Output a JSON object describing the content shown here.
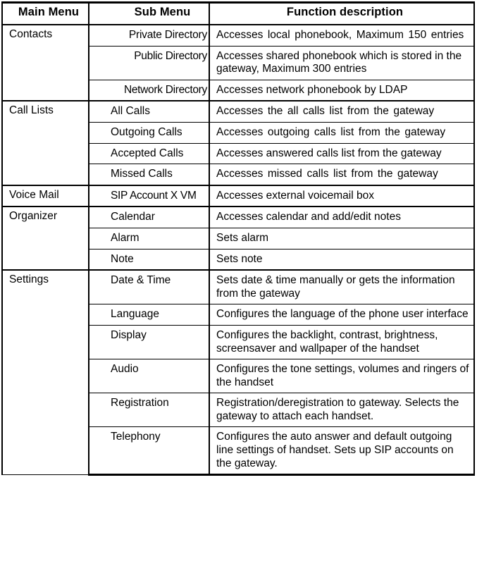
{
  "table": {
    "headers": {
      "main_menu": "Main Menu",
      "sub_menu": "Sub Menu",
      "function_description": "Function description"
    },
    "groups": [
      {
        "main_menu": "Contacts",
        "sub_align": "right",
        "rows": [
          {
            "sub_menu": "Private  Directory",
            "description": "Accesses local phonebook, Maximum 150 entries",
            "desc_spaced": true
          },
          {
            "sub_menu": "Public Directory",
            "description": "Accesses shared phonebook which is stored in  the  gateway,  Maximum  300  entries",
            "desc_spaced": false
          },
          {
            "sub_menu": "Network Directory",
            "description": "Accesses network phonebook by LDAP",
            "desc_spaced": false
          }
        ]
      },
      {
        "main_menu": "Call Lists",
        "sub_align": "left",
        "rows": [
          {
            "sub_menu": "All Calls",
            "description": "Accesses the all calls list from the gateway",
            "desc_spaced": true
          },
          {
            "sub_menu": "Outgoing  Calls",
            "description": "Accesses outgoing calls list from the gateway",
            "desc_spaced": true
          },
          {
            "sub_menu": "Accepted Calls",
            "description": "Accesses answered calls list from the gateway",
            "desc_spaced": false
          },
          {
            "sub_menu": "Missed Calls",
            "description": "Accesses missed calls list from the gateway",
            "desc_spaced": true
          }
        ]
      },
      {
        "main_menu": "Voice Mail",
        "sub_align": "left",
        "rows": [
          {
            "sub_menu": "SIP Account X VM",
            "description": "Accesses external voicemail box",
            "desc_spaced": false
          }
        ]
      },
      {
        "main_menu": "Organizer",
        "sub_align": "left",
        "rows": [
          {
            "sub_menu": "Calendar",
            "description": "Accesses calendar and add/edit notes",
            "desc_spaced": false
          },
          {
            "sub_menu": "Alarm",
            "description": "Sets alarm",
            "desc_spaced": false
          },
          {
            "sub_menu": "Note",
            "description": "Sets note",
            "desc_spaced": false
          }
        ]
      },
      {
        "main_menu": "Settings",
        "sub_align": "left",
        "rows": [
          {
            "sub_menu": "Date & Time",
            "description": "Sets date & time manually or gets the information from the gateway",
            "desc_spaced": false
          },
          {
            "sub_menu": "Language",
            "description": "Configures  the  language  of  the  phone  user interface",
            "desc_spaced": false
          },
          {
            "sub_menu": "Display",
            "description": "Configures the backlight, contrast, brightness, screensaver and wallpaper of the handset",
            "desc_spaced": false
          },
          {
            "sub_menu": "Audio",
            "description": "Configures  the  tone  settings,  volumes  and ringers  of  the  handset",
            "desc_spaced": false
          },
          {
            "sub_menu": "Registration",
            "description": "Registration/deregistration to gateway. Selects the gateway to attach each handset.",
            "desc_spaced": false
          },
          {
            "sub_menu": "Telephony",
            "description": "Configures  the  auto  answer  and  default outgoing  line  settings of handset. Sets  up SIP  accounts  on  the  gateway.",
            "desc_spaced": false
          }
        ]
      }
    ]
  }
}
